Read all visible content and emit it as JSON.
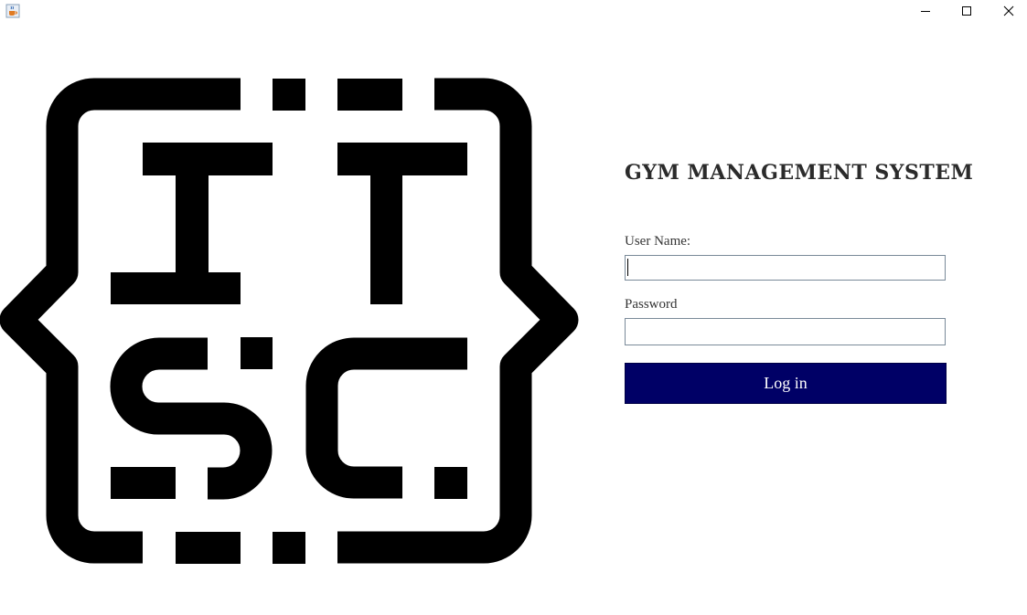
{
  "window": {
    "icon": "java-cup-icon",
    "controls": {
      "minimize": "minimize-icon",
      "maximize": "maximize-icon",
      "close": "close-icon"
    }
  },
  "logo": {
    "name": "ITSC logo",
    "text": "ITSC",
    "color": "#000000"
  },
  "login": {
    "title": "GYM MANAGEMENT SYSTEM",
    "username_label": "User Name:",
    "username_value": "",
    "password_label": "Password",
    "password_value": "",
    "button_label": "Log in",
    "button_color": "#000066"
  }
}
